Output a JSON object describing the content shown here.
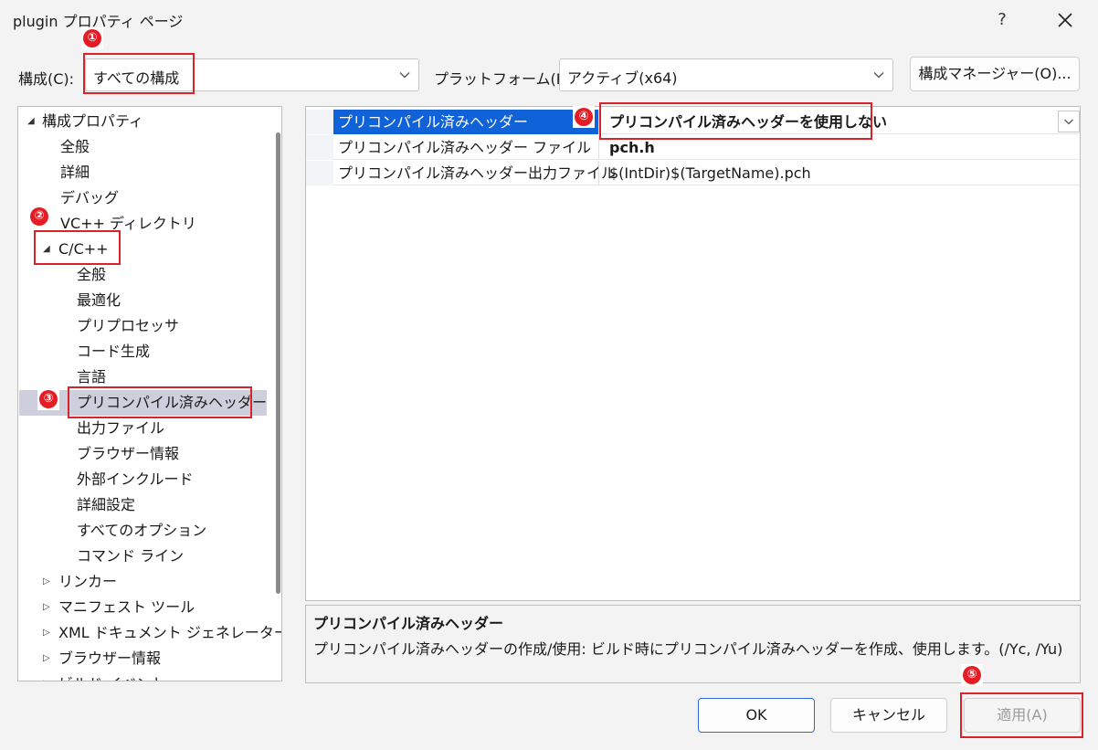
{
  "window": {
    "title": "plugin プロパティ ページ",
    "help": "?"
  },
  "config": {
    "label": "構成(C):",
    "value": "すべての構成",
    "platform_label": "プラットフォーム(P):",
    "platform_value": "アクティブ(x64)",
    "manager_button": "構成マネージャー(O)..."
  },
  "tree": {
    "root": "構成プロパティ",
    "items": [
      "全般",
      "詳細",
      "デバッグ",
      "VC++ ディレクトリ"
    ],
    "cpp": "C/C++",
    "cpp_children": [
      "全般",
      "最適化",
      "プリプロセッサ",
      "コード生成",
      "言語",
      "プリコンパイル済みヘッダー",
      "出力ファイル",
      "ブラウザー情報",
      "外部インクルード",
      "詳細設定",
      "すべてのオプション",
      "コマンド ライン"
    ],
    "collapsed": [
      "リンカー",
      "マニフェスト ツール",
      "XML ドキュメント ジェネレーター",
      "ブラウザー情報",
      "ビルド イベント"
    ]
  },
  "grid": {
    "rows": [
      {
        "name": "プリコンパイル済みヘッダー",
        "value": "プリコンパイル済みヘッダーを使用しない"
      },
      {
        "name": "プリコンパイル済みヘッダー ファイル",
        "value": "pch.h"
      },
      {
        "name": "プリコンパイル済みヘッダー出力ファイル",
        "value": "$(IntDir)$(TargetName).pch"
      }
    ]
  },
  "description": {
    "title": "プリコンパイル済みヘッダー",
    "text": "プリコンパイル済みヘッダーの作成/使用: ビルド時にプリコンパイル済みヘッダーを作成、使用します。(/Yc, /Yu)"
  },
  "buttons": {
    "ok": "OK",
    "cancel": "キャンセル",
    "apply": "適用(A)"
  },
  "annotations": {
    "b1": "①",
    "b2": "②",
    "b3": "③",
    "b4": "④",
    "b5": "⑤"
  },
  "colors": {
    "accent": "#0f62d8",
    "annotation": "#d9232a",
    "selection": "#cdd0dc"
  }
}
